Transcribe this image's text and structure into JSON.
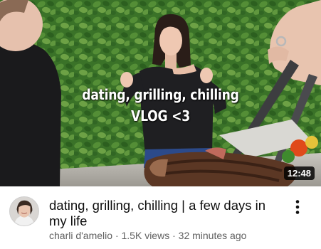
{
  "thumbnail": {
    "overlay_line_1": "dating, grilling, chilling",
    "overlay_line_2": "VLOG <3",
    "duration": "12:48"
  },
  "video": {
    "title": "dating, grilling, chilling | a few days in my life",
    "channel": "charli d'amelio",
    "views": "1.5K views",
    "age": "32 minutes ago",
    "separator": "·"
  },
  "icons": {
    "more": "more-vert-icon",
    "avatar": "channel-avatar"
  },
  "colors": {
    "title_text": "#0f0f0f",
    "secondary_text": "#606060",
    "duration_badge": "#000000"
  }
}
